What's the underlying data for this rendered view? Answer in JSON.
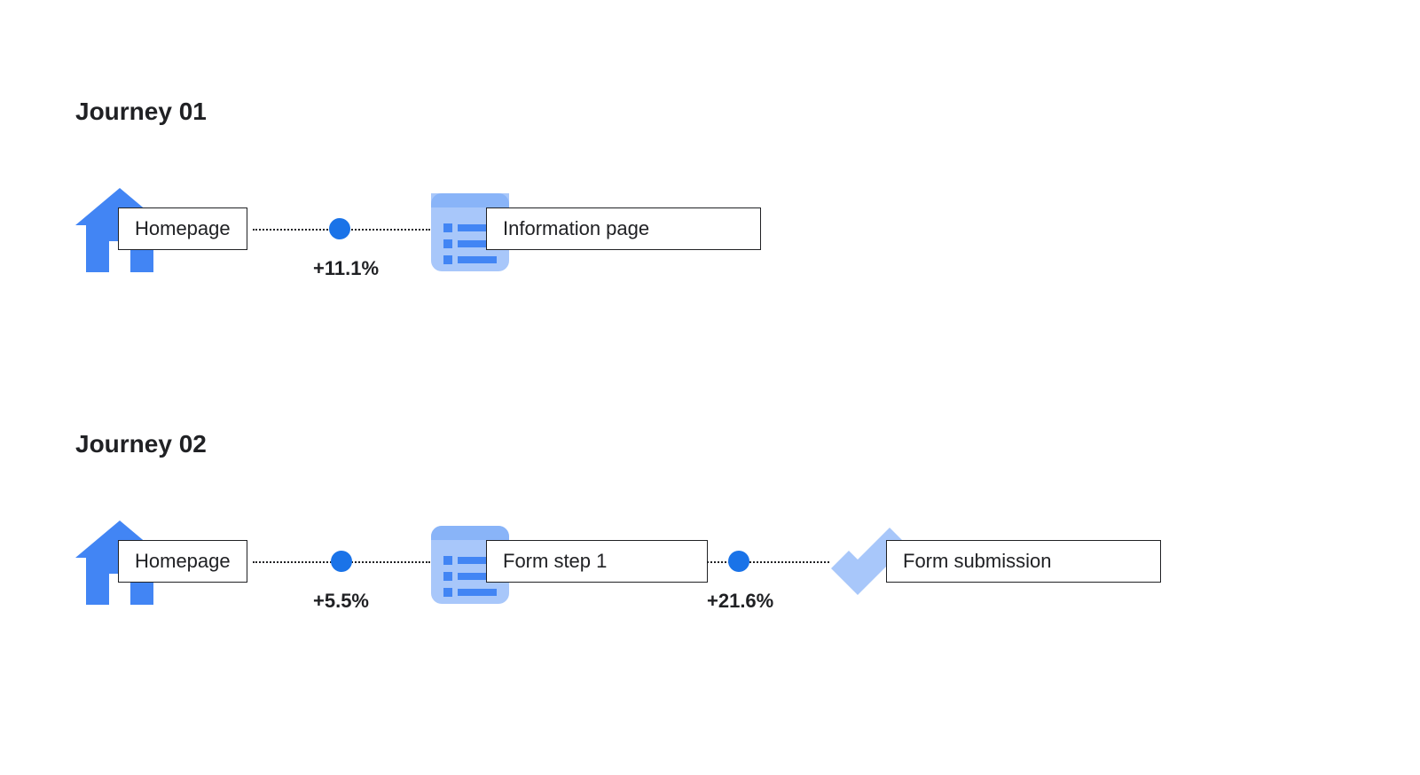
{
  "journeys": [
    {
      "title": "Journey 01",
      "steps": [
        {
          "label": "Homepage",
          "icon": "home"
        },
        {
          "label": "Information page",
          "icon": "page"
        }
      ],
      "connectors": [
        {
          "percent": "+11.1%"
        }
      ]
    },
    {
      "title": "Journey 02",
      "steps": [
        {
          "label": "Homepage",
          "icon": "home"
        },
        {
          "label": "Form step 1",
          "icon": "page"
        },
        {
          "label": "Form submission",
          "icon": "check"
        }
      ],
      "connectors": [
        {
          "percent": "+5.5%"
        },
        {
          "percent": "+21.6%"
        }
      ]
    }
  ],
  "colors": {
    "primary": "#4285f4",
    "primary_light": "#a8c7fa",
    "dot": "#1a73e8"
  }
}
